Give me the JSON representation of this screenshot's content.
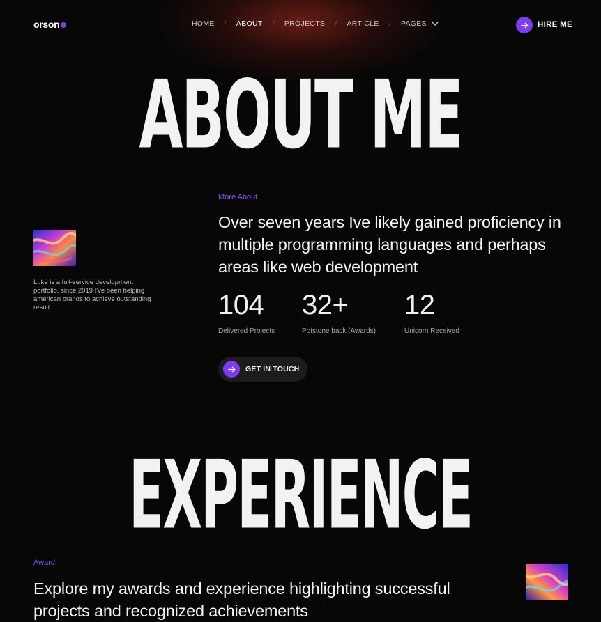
{
  "brand": {
    "name": "orson",
    "accent": "#7d3cf0"
  },
  "nav": {
    "items": [
      {
        "label": "HOME"
      },
      {
        "label": "ABOUT"
      },
      {
        "label": "PROJECTS"
      },
      {
        "label": "ARTICLE"
      },
      {
        "label": "PAGES"
      }
    ],
    "active": "ABOUT",
    "separator": "/",
    "pages_icon": "chevron-down-icon"
  },
  "hire": {
    "label": "HIRE ME",
    "icon": "arrow-right-icon"
  },
  "hero": {
    "title": "ABOUT ME"
  },
  "about": {
    "eyebrow": "More About",
    "headline": "Over seven years Ive likely gained proficiency in multiple programming languages and  perhaps areas like web development",
    "side_text": "Luke is a full-service development portfolio, since 2019 I've been helping american brands to achieve outstanding result",
    "stats": [
      {
        "value": "104",
        "label": "Delivered Projects"
      },
      {
        "value": "32+",
        "label": "Potstone back (Awards)"
      },
      {
        "value": "12",
        "label": "Unicorn Received"
      }
    ],
    "cta": {
      "label": "GET IN TOUCH",
      "icon": "arrow-right-icon"
    }
  },
  "experience": {
    "title": "EXPERIENCE",
    "eyebrow": "Award",
    "headline": "Explore my awards and experience highlighting successful projects and recognized achievements"
  }
}
